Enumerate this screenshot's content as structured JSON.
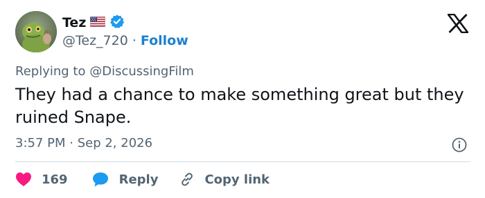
{
  "user": {
    "display_name": "Tez",
    "handle": "@Tez_720",
    "separator": "·",
    "follow_label": "Follow",
    "avatar_icon": "gecko-avatar",
    "flag_icon": "us-flag-icon",
    "verified_icon": "verified-badge-icon",
    "verified_color": "#1d9bf0"
  },
  "platform": {
    "logo_icon": "x-logo-icon"
  },
  "tweet": {
    "replying_prefix": "Replying to",
    "replying_handle": "@DiscussingFilm",
    "text": "They had a chance to make something great but they ruined Snape.",
    "timestamp": "3:57 PM · Sep 2, 2026",
    "info_icon": "info-icon"
  },
  "actions": {
    "like_count": "169",
    "like_icon": "heart-icon",
    "like_color": "#f91880",
    "reply_label": "Reply",
    "reply_icon": "speech-bubble-icon",
    "reply_color": "#1d9bf0",
    "copy_label": "Copy link",
    "copy_icon": "link-icon"
  },
  "colors": {
    "text_primary": "#0f1419",
    "text_secondary": "#536471",
    "accent": "#1d7fd1",
    "divider": "#cfd9de"
  }
}
